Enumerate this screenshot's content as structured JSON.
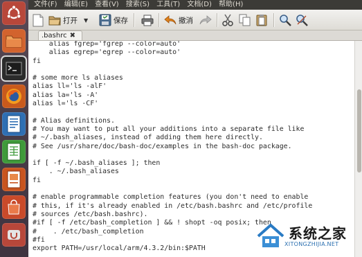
{
  "menu": {
    "items": [
      "文件(F)",
      "编辑(E)",
      "查看(V)",
      "搜索(S)",
      "工具(T)",
      "文档(D)",
      "帮助(H)"
    ]
  },
  "toolbar": {
    "open_label": "打开",
    "save_label": "保存",
    "undo_label": "撤消"
  },
  "tabs": [
    {
      "label": ".bashrc"
    }
  ],
  "editor": {
    "lines": [
      "    alias fgrep='fgrep --color=auto'",
      "    alias egrep='egrep --color=auto'",
      "fi",
      "",
      "# some more ls aliases",
      "alias ll='ls -alF'",
      "alias la='ls -A'",
      "alias l='ls -CF'",
      "",
      "# Alias definitions.",
      "# You may want to put all your additions into a separate file like",
      "# ~/.bash_aliases, instead of adding them here directly.",
      "# See /usr/share/doc/bash-doc/examples in the bash-doc package.",
      "",
      "if [ -f ~/.bash_aliases ]; then",
      "    . ~/.bash_aliases",
      "fi",
      "",
      "# enable programmable completion features (you don't need to enable",
      "# this, if it's already enabled in /etc/bash.bashrc and /etc/profile",
      "# sources /etc/bash.bashrc).",
      "#if [ -f /etc/bash_completion ] && ! shopt -oq posix; then",
      "#    . /etc/bash_completion",
      "#fi",
      "export PATH=/usr/local/arm/4.3.2/bin:$PATH"
    ]
  },
  "watermark": {
    "name": "系统之家",
    "url": "XITONGZHIJIA.NET"
  }
}
